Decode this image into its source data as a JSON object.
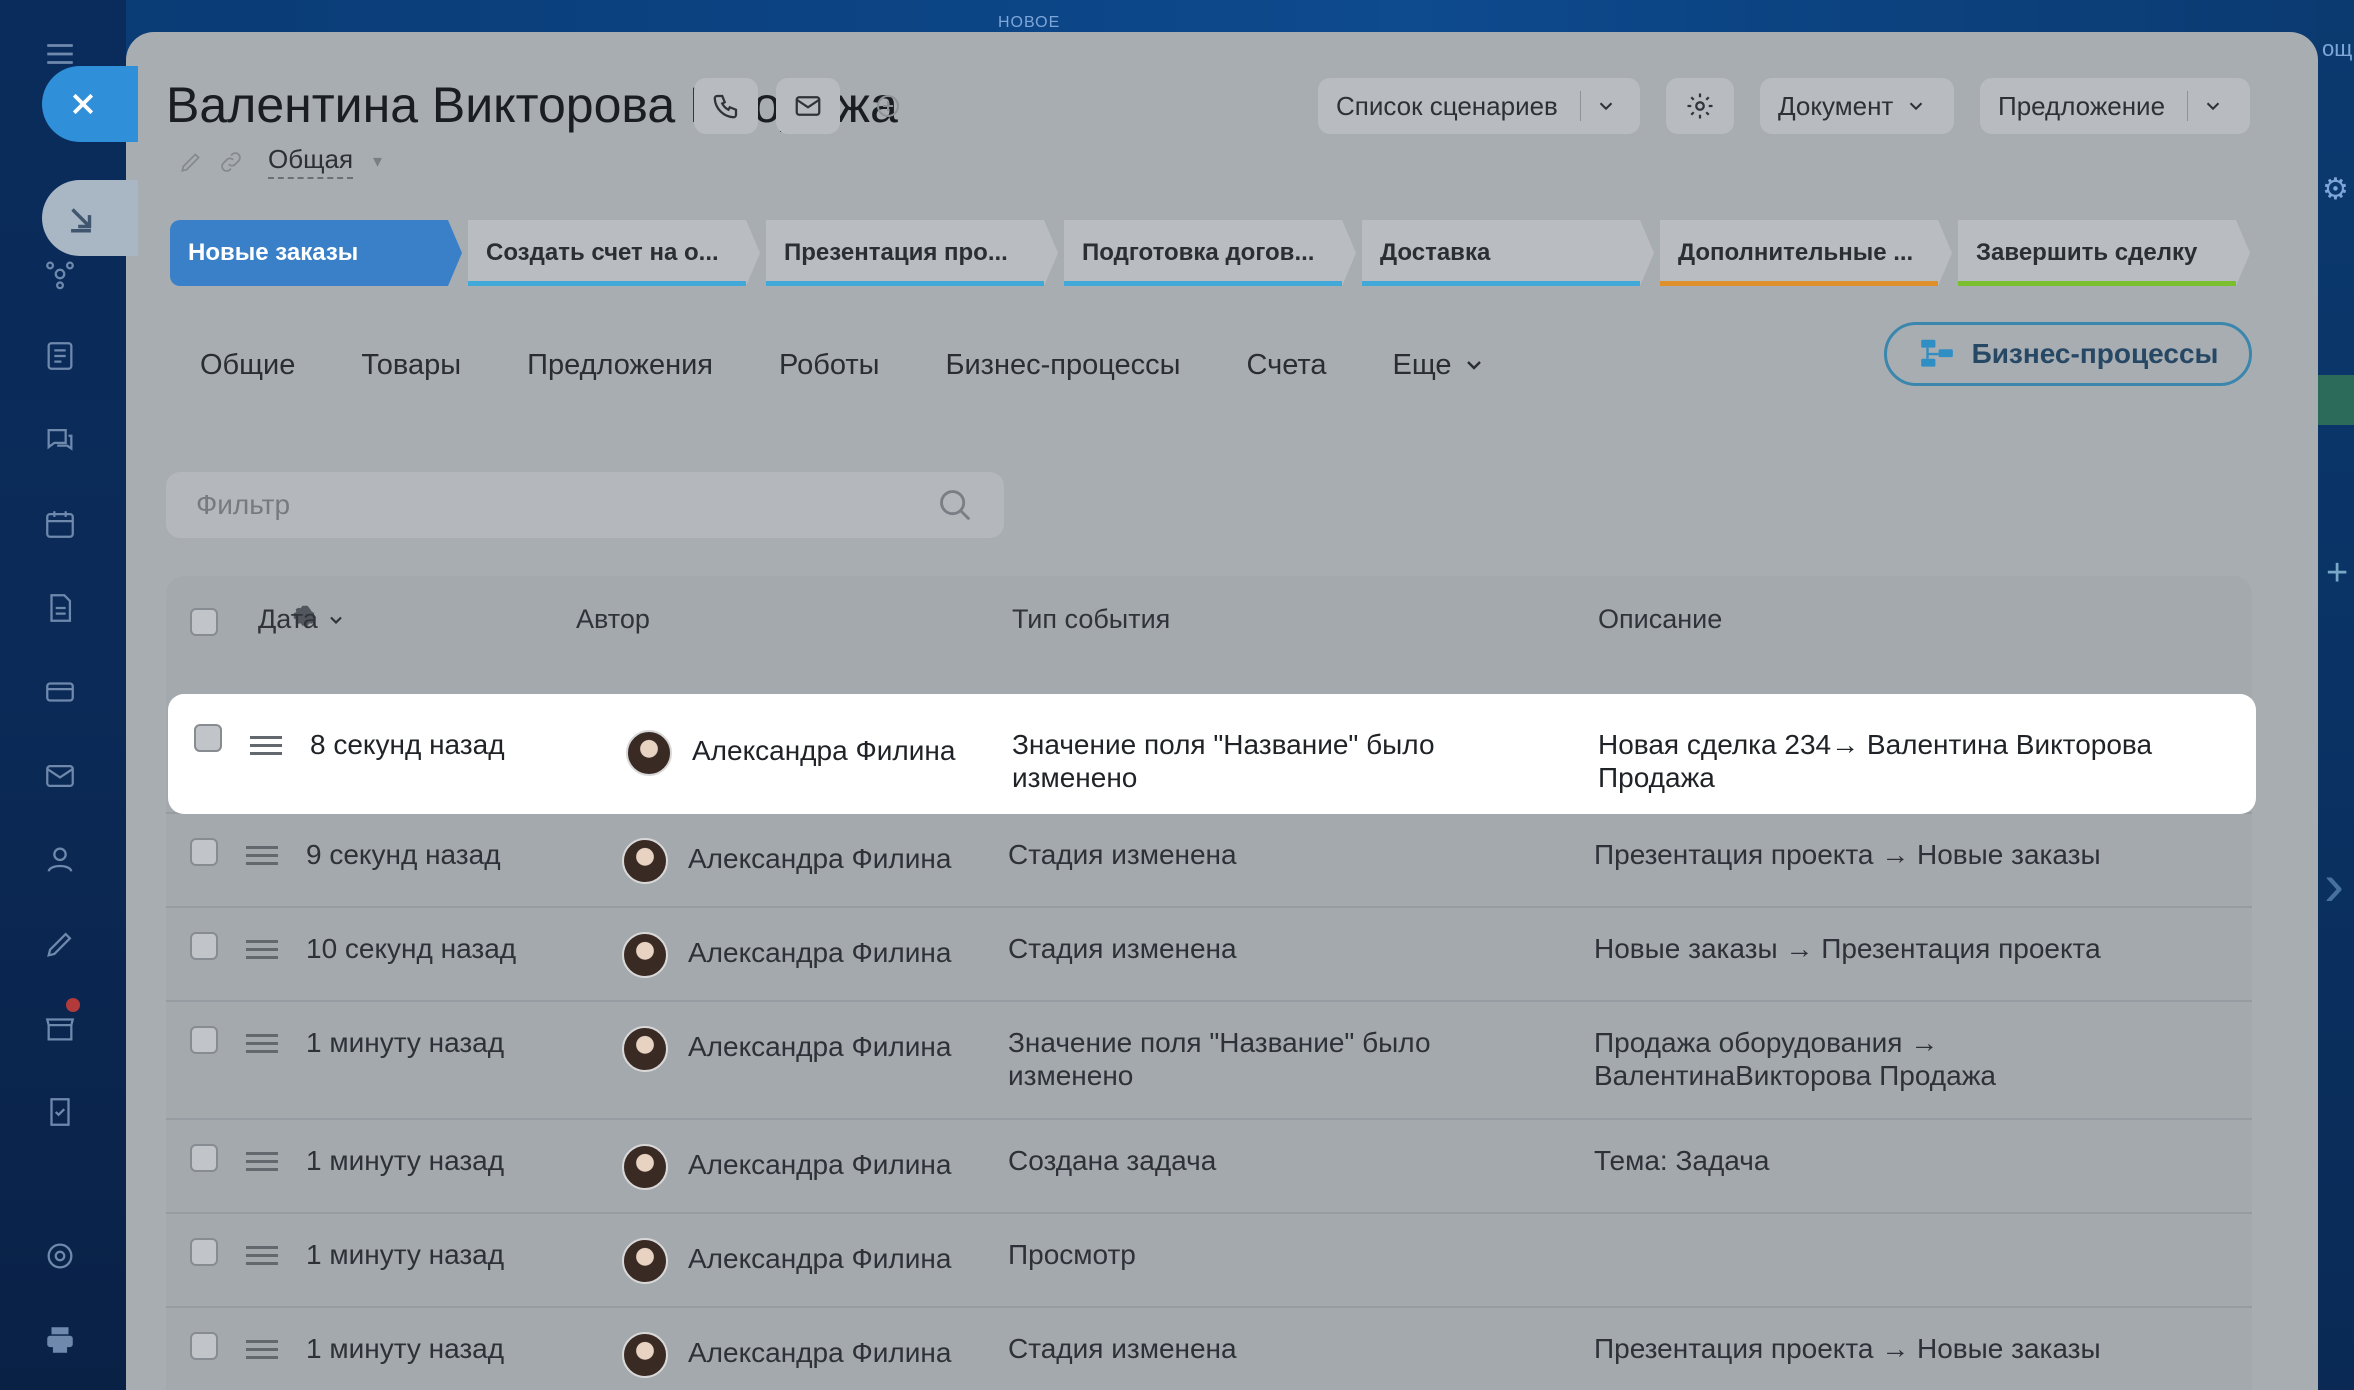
{
  "background": {
    "new_label": "НОВОЕ",
    "right_strip_text": "ощ"
  },
  "deal": {
    "title": "Валентина Викторова Продажа",
    "category": "Общая"
  },
  "header_buttons": {
    "scenarios": "Список сценариев",
    "document": "Документ",
    "offer": "Предложение"
  },
  "stages": [
    {
      "label": "Новые заказы",
      "color": "#3a80c8",
      "active": true
    },
    {
      "label": "Создать счет на о...",
      "color": "#42a8d8"
    },
    {
      "label": "Презентация про...",
      "color": "#42a8d8"
    },
    {
      "label": "Подготовка догов...",
      "color": "#42a8d8"
    },
    {
      "label": "Доставка",
      "color": "#42a8d8"
    },
    {
      "label": "Дополнительные ...",
      "color": "#e0902a"
    },
    {
      "label": "Завершить сделку",
      "color": "#7bbf2e"
    }
  ],
  "tabs": [
    "Общие",
    "Товары",
    "Предложения",
    "Роботы",
    "Бизнес-процессы",
    "Счета",
    "Еще"
  ],
  "bp_button": "Бизнес-процессы",
  "filter": {
    "placeholder": "Фильтр",
    "value": ""
  },
  "table": {
    "columns": {
      "date": "Дата",
      "author": "Автор",
      "event_type": "Тип события",
      "description": "Описание"
    },
    "rows": [
      {
        "date": "8 секунд назад",
        "author": "Александра Филина",
        "event": "Значение поля \"Название\" было изменено",
        "description": "Новая сделка 234→ Валентина Викторова Продажа",
        "highlight": true
      },
      {
        "date": "9 секунд назад",
        "author": "Александра Филина",
        "event": "Стадия изменена",
        "description": "Презентация проекта → Новые заказы"
      },
      {
        "date": "10 секунд назад",
        "author": "Александра Филина",
        "event": "Стадия изменена",
        "description": "Новые заказы → Презентация проекта"
      },
      {
        "date": "1 минуту назад",
        "author": "Александра Филина",
        "event": "Значение поля \"Название\" было изменено",
        "description": "Продажа оборудования → ВалентинаВикторова Продажа"
      },
      {
        "date": "1 минуту назад",
        "author": "Александра Филина",
        "event": "Создана задача",
        "description": "Тема: Задача"
      },
      {
        "date": "1 минуту назад",
        "author": "Александра Филина",
        "event": "Просмотр",
        "description": ""
      },
      {
        "date": "1 минуту назад",
        "author": "Александра Филина",
        "event": "Стадия изменена",
        "description": "Презентация проекта → Новые заказы"
      }
    ]
  }
}
